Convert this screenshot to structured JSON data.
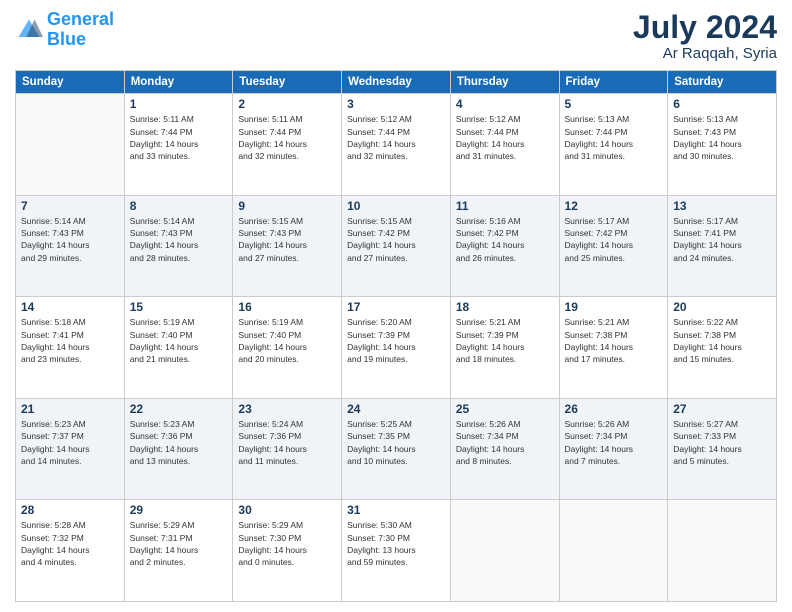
{
  "header": {
    "logo_line1": "General",
    "logo_line2": "Blue",
    "month_year": "July 2024",
    "location": "Ar Raqqah, Syria"
  },
  "days_of_week": [
    "Sunday",
    "Monday",
    "Tuesday",
    "Wednesday",
    "Thursday",
    "Friday",
    "Saturday"
  ],
  "weeks": [
    [
      {
        "day": "",
        "info": ""
      },
      {
        "day": "1",
        "info": "Sunrise: 5:11 AM\nSunset: 7:44 PM\nDaylight: 14 hours\nand 33 minutes."
      },
      {
        "day": "2",
        "info": "Sunrise: 5:11 AM\nSunset: 7:44 PM\nDaylight: 14 hours\nand 32 minutes."
      },
      {
        "day": "3",
        "info": "Sunrise: 5:12 AM\nSunset: 7:44 PM\nDaylight: 14 hours\nand 32 minutes."
      },
      {
        "day": "4",
        "info": "Sunrise: 5:12 AM\nSunset: 7:44 PM\nDaylight: 14 hours\nand 31 minutes."
      },
      {
        "day": "5",
        "info": "Sunrise: 5:13 AM\nSunset: 7:44 PM\nDaylight: 14 hours\nand 31 minutes."
      },
      {
        "day": "6",
        "info": "Sunrise: 5:13 AM\nSunset: 7:43 PM\nDaylight: 14 hours\nand 30 minutes."
      }
    ],
    [
      {
        "day": "7",
        "info": "Sunrise: 5:14 AM\nSunset: 7:43 PM\nDaylight: 14 hours\nand 29 minutes."
      },
      {
        "day": "8",
        "info": "Sunrise: 5:14 AM\nSunset: 7:43 PM\nDaylight: 14 hours\nand 28 minutes."
      },
      {
        "day": "9",
        "info": "Sunrise: 5:15 AM\nSunset: 7:43 PM\nDaylight: 14 hours\nand 27 minutes."
      },
      {
        "day": "10",
        "info": "Sunrise: 5:15 AM\nSunset: 7:42 PM\nDaylight: 14 hours\nand 27 minutes."
      },
      {
        "day": "11",
        "info": "Sunrise: 5:16 AM\nSunset: 7:42 PM\nDaylight: 14 hours\nand 26 minutes."
      },
      {
        "day": "12",
        "info": "Sunrise: 5:17 AM\nSunset: 7:42 PM\nDaylight: 14 hours\nand 25 minutes."
      },
      {
        "day": "13",
        "info": "Sunrise: 5:17 AM\nSunset: 7:41 PM\nDaylight: 14 hours\nand 24 minutes."
      }
    ],
    [
      {
        "day": "14",
        "info": "Sunrise: 5:18 AM\nSunset: 7:41 PM\nDaylight: 14 hours\nand 23 minutes."
      },
      {
        "day": "15",
        "info": "Sunrise: 5:19 AM\nSunset: 7:40 PM\nDaylight: 14 hours\nand 21 minutes."
      },
      {
        "day": "16",
        "info": "Sunrise: 5:19 AM\nSunset: 7:40 PM\nDaylight: 14 hours\nand 20 minutes."
      },
      {
        "day": "17",
        "info": "Sunrise: 5:20 AM\nSunset: 7:39 PM\nDaylight: 14 hours\nand 19 minutes."
      },
      {
        "day": "18",
        "info": "Sunrise: 5:21 AM\nSunset: 7:39 PM\nDaylight: 14 hours\nand 18 minutes."
      },
      {
        "day": "19",
        "info": "Sunrise: 5:21 AM\nSunset: 7:38 PM\nDaylight: 14 hours\nand 17 minutes."
      },
      {
        "day": "20",
        "info": "Sunrise: 5:22 AM\nSunset: 7:38 PM\nDaylight: 14 hours\nand 15 minutes."
      }
    ],
    [
      {
        "day": "21",
        "info": "Sunrise: 5:23 AM\nSunset: 7:37 PM\nDaylight: 14 hours\nand 14 minutes."
      },
      {
        "day": "22",
        "info": "Sunrise: 5:23 AM\nSunset: 7:36 PM\nDaylight: 14 hours\nand 13 minutes."
      },
      {
        "day": "23",
        "info": "Sunrise: 5:24 AM\nSunset: 7:36 PM\nDaylight: 14 hours\nand 11 minutes."
      },
      {
        "day": "24",
        "info": "Sunrise: 5:25 AM\nSunset: 7:35 PM\nDaylight: 14 hours\nand 10 minutes."
      },
      {
        "day": "25",
        "info": "Sunrise: 5:26 AM\nSunset: 7:34 PM\nDaylight: 14 hours\nand 8 minutes."
      },
      {
        "day": "26",
        "info": "Sunrise: 5:26 AM\nSunset: 7:34 PM\nDaylight: 14 hours\nand 7 minutes."
      },
      {
        "day": "27",
        "info": "Sunrise: 5:27 AM\nSunset: 7:33 PM\nDaylight: 14 hours\nand 5 minutes."
      }
    ],
    [
      {
        "day": "28",
        "info": "Sunrise: 5:28 AM\nSunset: 7:32 PM\nDaylight: 14 hours\nand 4 minutes."
      },
      {
        "day": "29",
        "info": "Sunrise: 5:29 AM\nSunset: 7:31 PM\nDaylight: 14 hours\nand 2 minutes."
      },
      {
        "day": "30",
        "info": "Sunrise: 5:29 AM\nSunset: 7:30 PM\nDaylight: 14 hours\nand 0 minutes."
      },
      {
        "day": "31",
        "info": "Sunrise: 5:30 AM\nSunset: 7:30 PM\nDaylight: 13 hours\nand 59 minutes."
      },
      {
        "day": "",
        "info": ""
      },
      {
        "day": "",
        "info": ""
      },
      {
        "day": "",
        "info": ""
      }
    ]
  ]
}
